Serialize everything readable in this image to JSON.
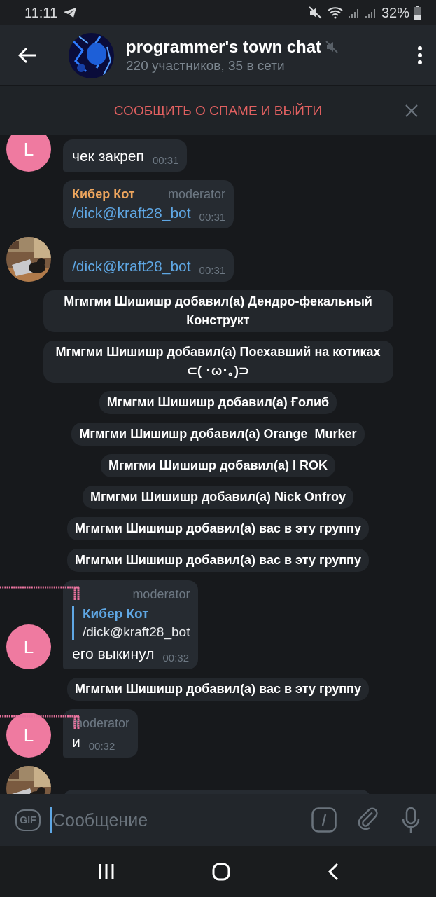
{
  "status_bar": {
    "time": "11:11",
    "battery": "32%"
  },
  "header": {
    "title": "programmer's town chat",
    "muted": true,
    "subtitle": "220 участников, 35 в сети"
  },
  "spam_bar": {
    "action": "СООБЩИТЬ О СПАМЕ И ВЫЙТИ"
  },
  "messages": [
    {
      "kind": "message",
      "avatar": {
        "kind": "letter",
        "letter": "L",
        "color": "#ef7aa0"
      },
      "text": "чек закреп",
      "link": false,
      "time": "00:31",
      "flagged": false
    },
    {
      "kind": "message",
      "sender": {
        "name": "Кибер Кот",
        "color": "#eea65e"
      },
      "badge": "moderator",
      "text": "/dick@kraft28_bot",
      "link": true,
      "time": "00:31",
      "flagged": false
    },
    {
      "kind": "message",
      "text": "/dick@kraft28_bot",
      "link": true,
      "time": "00:31",
      "flagged": false
    },
    {
      "kind": "service",
      "text": "Мгмгми Шишишр добавил(а) Дендро-фекальный Конструкт"
    },
    {
      "kind": "service",
      "text": "Мгмгми Шишишр добавил(а) Поехавший на котиках ⊂( ･ω･｡)⊃"
    },
    {
      "kind": "service",
      "text": "Мгмгми Шишишр добавил(а) Ғолиб"
    },
    {
      "kind": "service",
      "text": "Мгмгми Шишишр добавил(а) Orange_Murker"
    },
    {
      "kind": "service",
      "text": "Мгмгми Шишишр добавил(а) I ROK"
    },
    {
      "kind": "service",
      "text": "Мгмгми Шишишр добавил(а) Nick Onfroy"
    },
    {
      "kind": "service",
      "text": "Мгмгми Шишишр добавил(а) вас в эту группу"
    },
    {
      "kind": "service",
      "text": "Мгмгми Шишишр добавил(а) вас в эту группу"
    },
    {
      "kind": "message",
      "avatar": {
        "kind": "letter",
        "letter": "L",
        "color": "#ef7aa0"
      },
      "badge": "moderator",
      "reply": {
        "sender": "Кибер Кот",
        "text": "/dick@kraft28_bot"
      },
      "text": "его выкинул",
      "link": false,
      "time": "00:32",
      "flagged": true
    },
    {
      "kind": "service",
      "text": "Мгмгми Шишишр добавил(а) вас в эту группу"
    },
    {
      "kind": "message",
      "avatar": {
        "kind": "letter",
        "letter": "L",
        "color": "#ef7aa0"
      },
      "badge": "moderator",
      "text": "и",
      "link": false,
      "time": "00:32",
      "flagged": true
    },
    {
      "kind": "message",
      "flagged": false
    }
  ],
  "composer": {
    "gif": "GIF",
    "placeholder": "Сообщение"
  }
}
